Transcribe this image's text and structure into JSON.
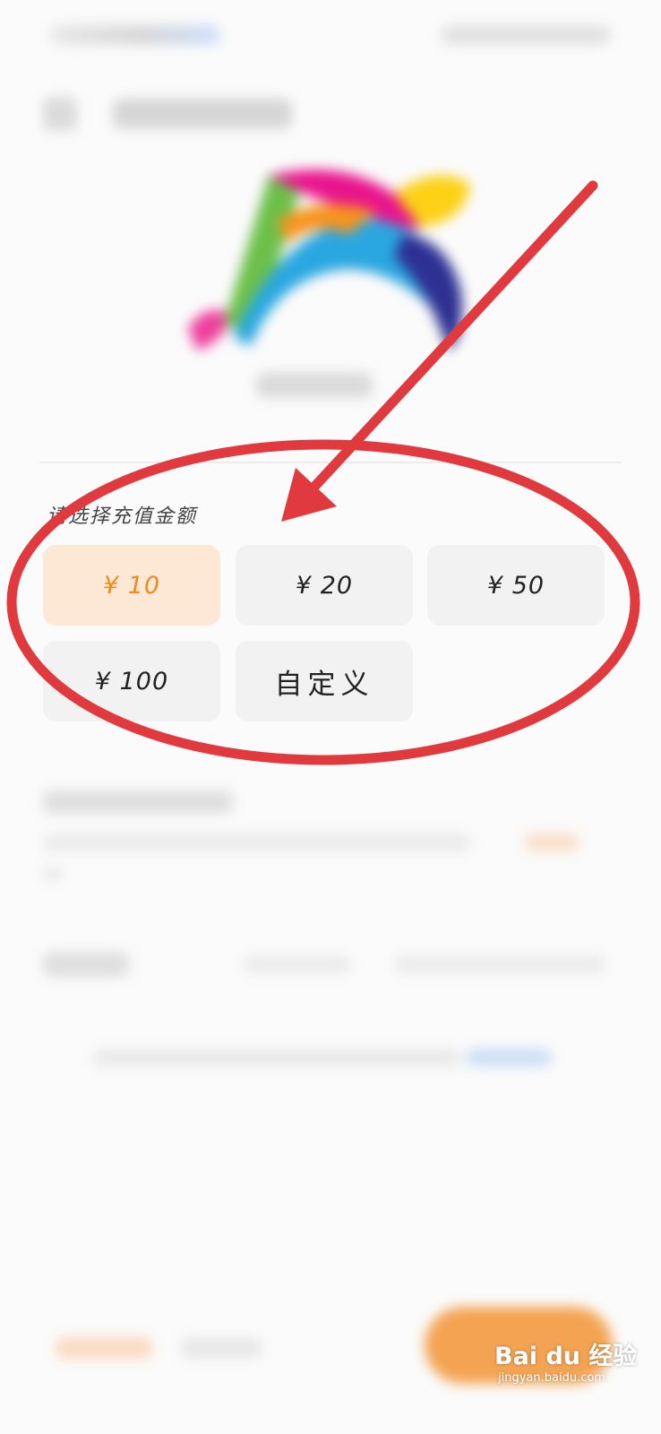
{
  "amount_section": {
    "label": "请选择充值金额",
    "options": [
      {
        "label": "¥ 10",
        "selected": true
      },
      {
        "label": "¥ 20",
        "selected": false
      },
      {
        "label": "¥ 50",
        "selected": false
      },
      {
        "label": "¥ 100",
        "selected": false
      },
      {
        "label": "自定义",
        "selected": false
      }
    ]
  },
  "colors": {
    "selected_background": "#fde7d5",
    "selected_text": "#f08a1c",
    "option_background": "#f2f2f2",
    "annotation_red": "#e0393e",
    "pay_button": "#f39a3f"
  },
  "watermark": {
    "brand": "Bai du 经验",
    "site": "jingyan.baidu.com"
  }
}
